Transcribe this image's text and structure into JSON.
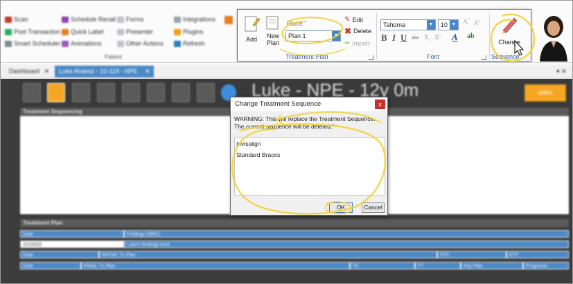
{
  "ribbon": {
    "blurred_left": {
      "col1": [
        "Scan",
        "Post Transaction",
        "Smart Scheduler"
      ],
      "col2": [
        "Schedule Recall",
        "Quick Label",
        "Animations"
      ],
      "col3": [
        "Forms",
        "Presenter",
        "Other Actions"
      ],
      "col4": [
        "Integrations",
        "Plugins",
        "Refresh"
      ],
      "group_label": "Patient"
    },
    "treatment_plan": {
      "add_label": "Add",
      "new_plan_label": "New Plan",
      "plans_label": "Plans",
      "plan_selected": "Plan 1",
      "edit_label": "Edit",
      "delete_label": "Delete",
      "import_label": "Import",
      "group_label": "Treatment Plan"
    },
    "font": {
      "family": "Tahoma",
      "size": "10",
      "group_label": "Font"
    },
    "sequence": {
      "change_label": "Change",
      "group_label": "Sequence"
    }
  },
  "tabs": [
    {
      "label": "Dashboard"
    },
    {
      "label": "Luke Alvarez - 10-119 - NPE"
    }
  ],
  "patient": {
    "header": "Luke - NPE - 12y 0m",
    "ortho_button": "ortho"
  },
  "sections": {
    "treatment_sequencing": "Treatment Sequencing",
    "treatment_plan": "Treatment Plan"
  },
  "grid": {
    "row1": [
      "Date",
      "Findings (NRC)"
    ],
    "row2": [
      "2/1/2022",
      "Luke's findings here"
    ],
    "row3": [
      "Date",
      "INITIAL Tx Plan",
      "ETC",
      "ETT"
    ],
    "row4": [
      "Date",
      "FINAL Tx Plan",
      "TC",
      "TT",
      "Pay Plan",
      "Prognosis"
    ]
  },
  "dialog": {
    "title": "Change Treatment Sequence",
    "close": "x",
    "warning": "WARNING: This will replace the Treatment Sequence. The current sequence will be deleted.\"",
    "items": [
      "Invisalign",
      "Standard Braces"
    ],
    "ok_label": "OK",
    "cancel_label": "Cancel"
  },
  "colors": {
    "accent": "#4b89c7",
    "orange": "#f5a623",
    "annotation": "#f2d23a",
    "close_red": "#c9302c"
  }
}
